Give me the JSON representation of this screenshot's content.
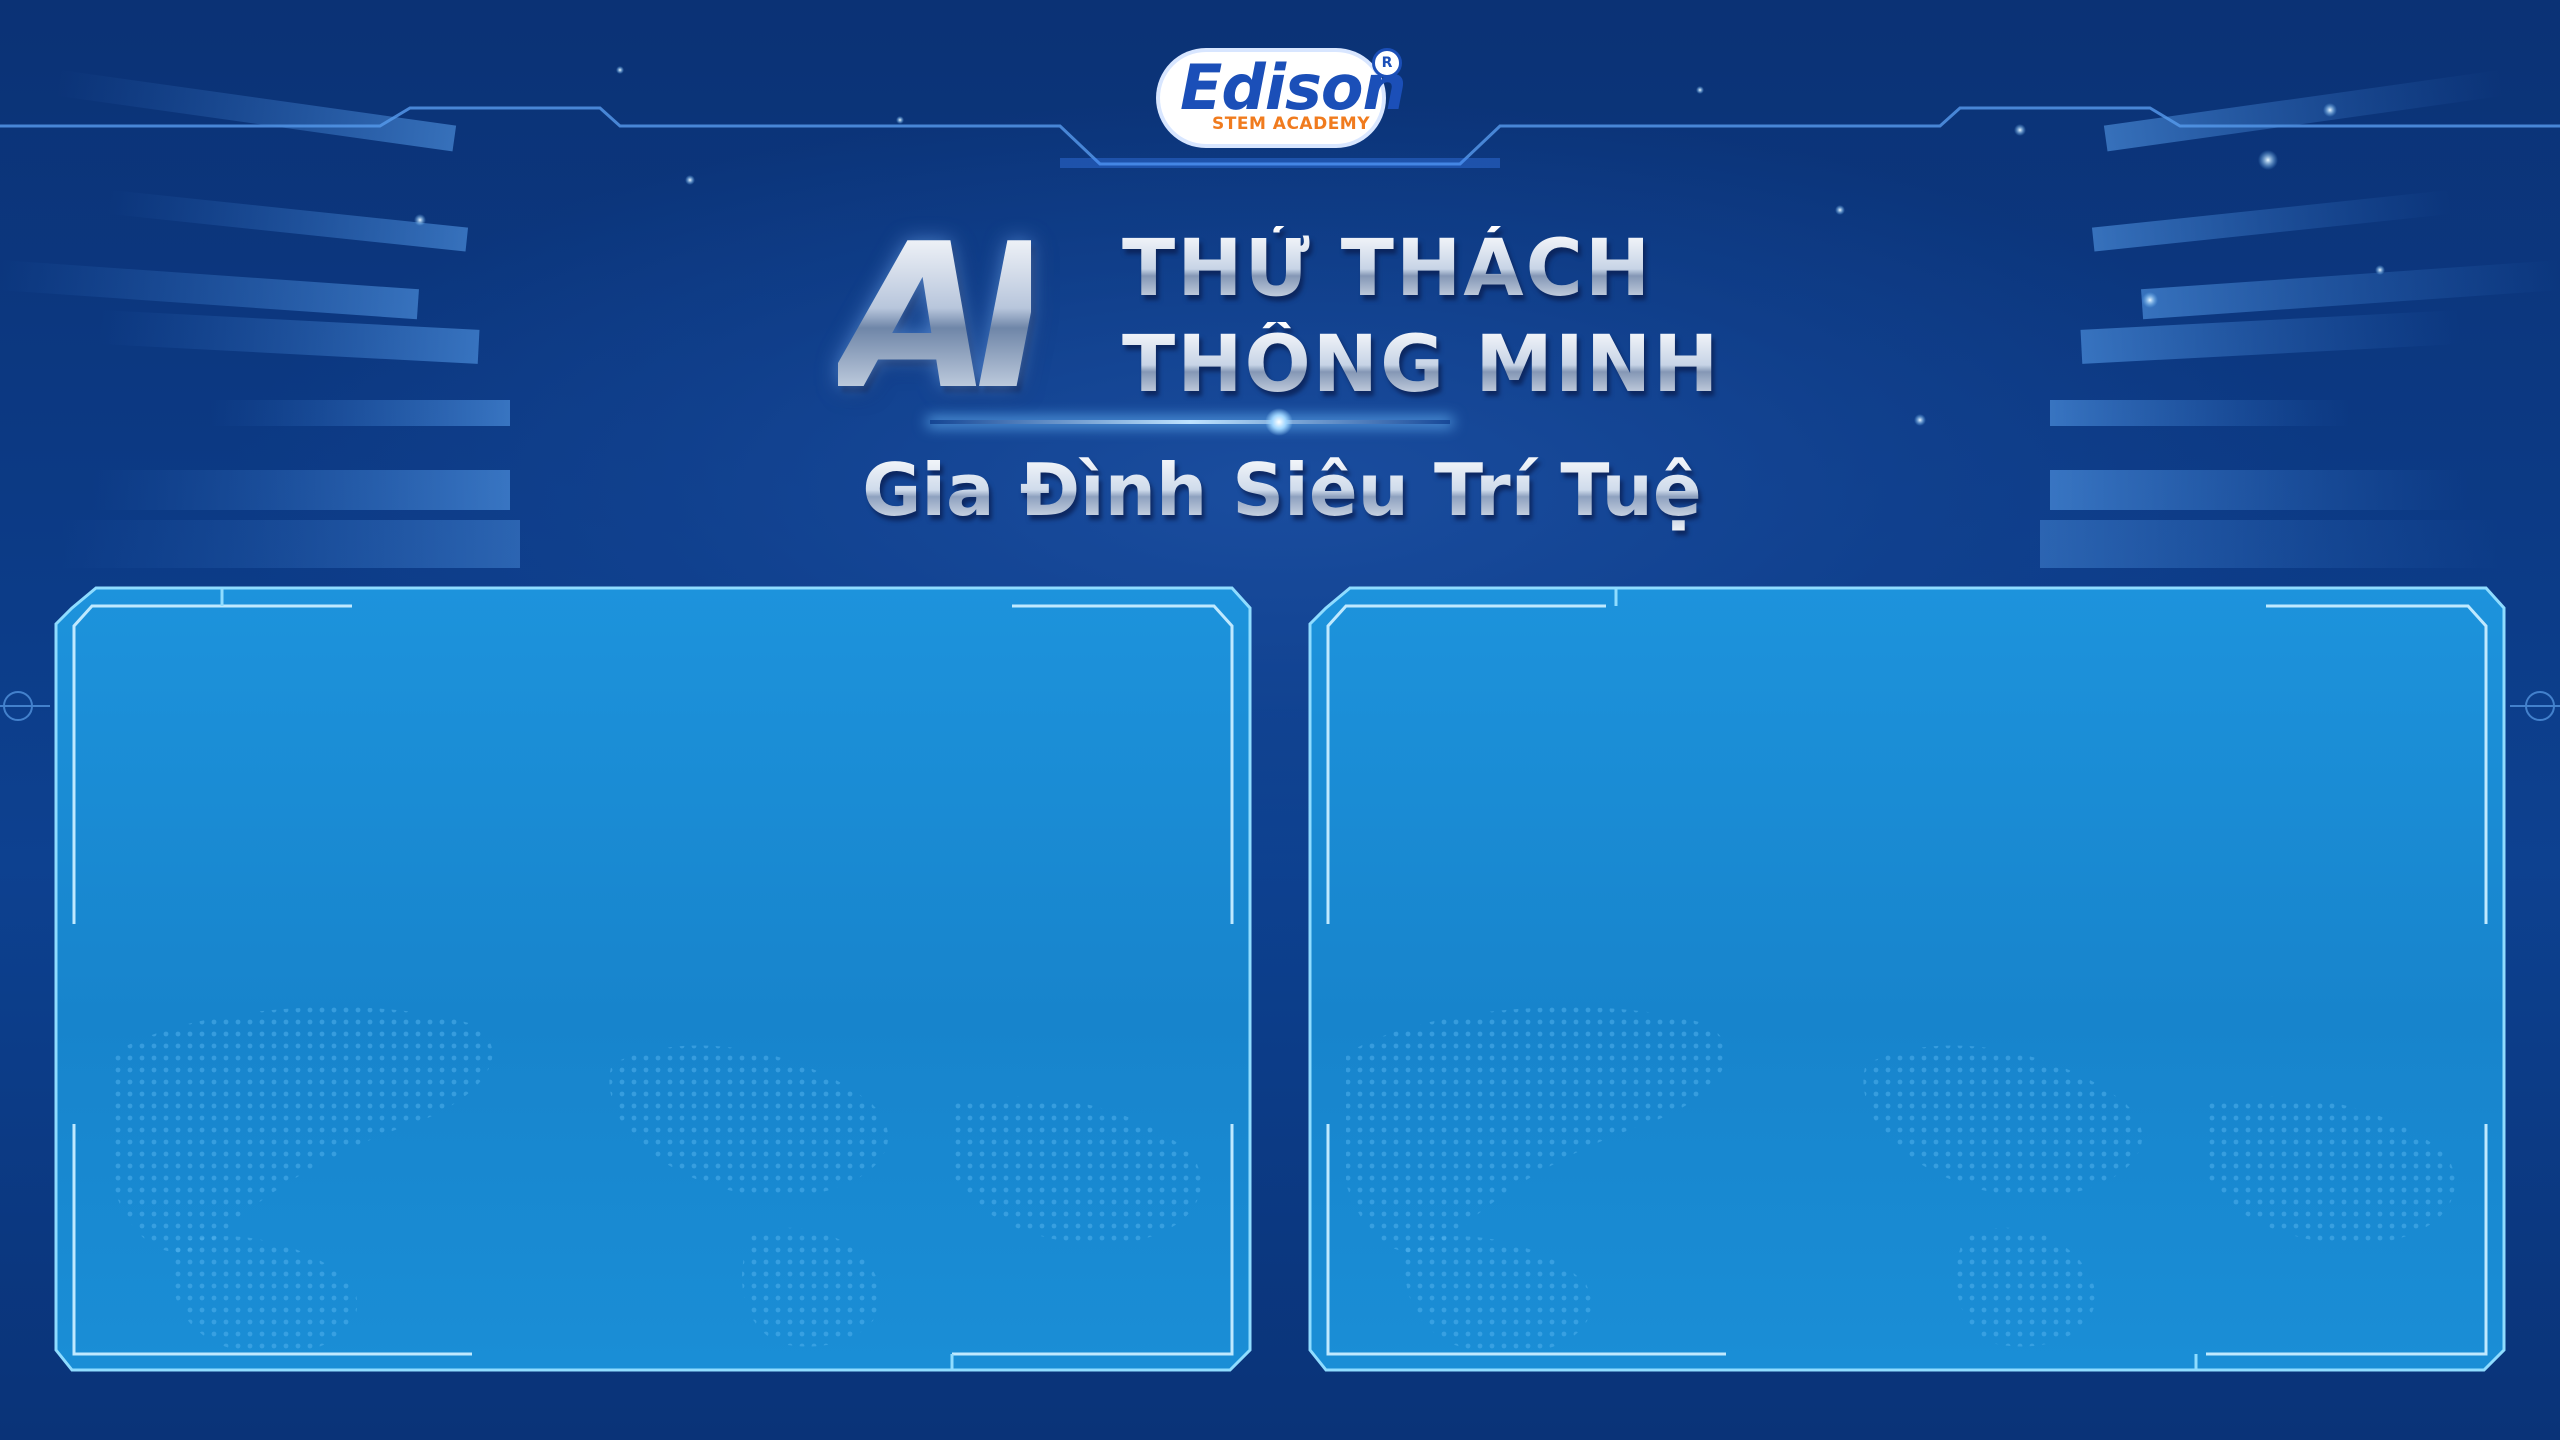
{
  "logo": {
    "brand": "Edison",
    "tagline": "STEM ACADEMY",
    "registered_mark": "R",
    "colors": {
      "brand_blue": "#1b4fb8",
      "tagline_orange": "#f07b1e"
    }
  },
  "title": {
    "ai": "AI",
    "line1": "THỬ THÁCH",
    "line2": "THÔNG MINH",
    "subtitle": "Gia Đình Siêu Trí Tuệ"
  },
  "panels": [
    {
      "name": "left"
    },
    {
      "name": "right"
    }
  ],
  "colors": {
    "background": "#0b3275",
    "panel_fill": "#1b8fd6",
    "panel_border": "#7fd0ff"
  }
}
